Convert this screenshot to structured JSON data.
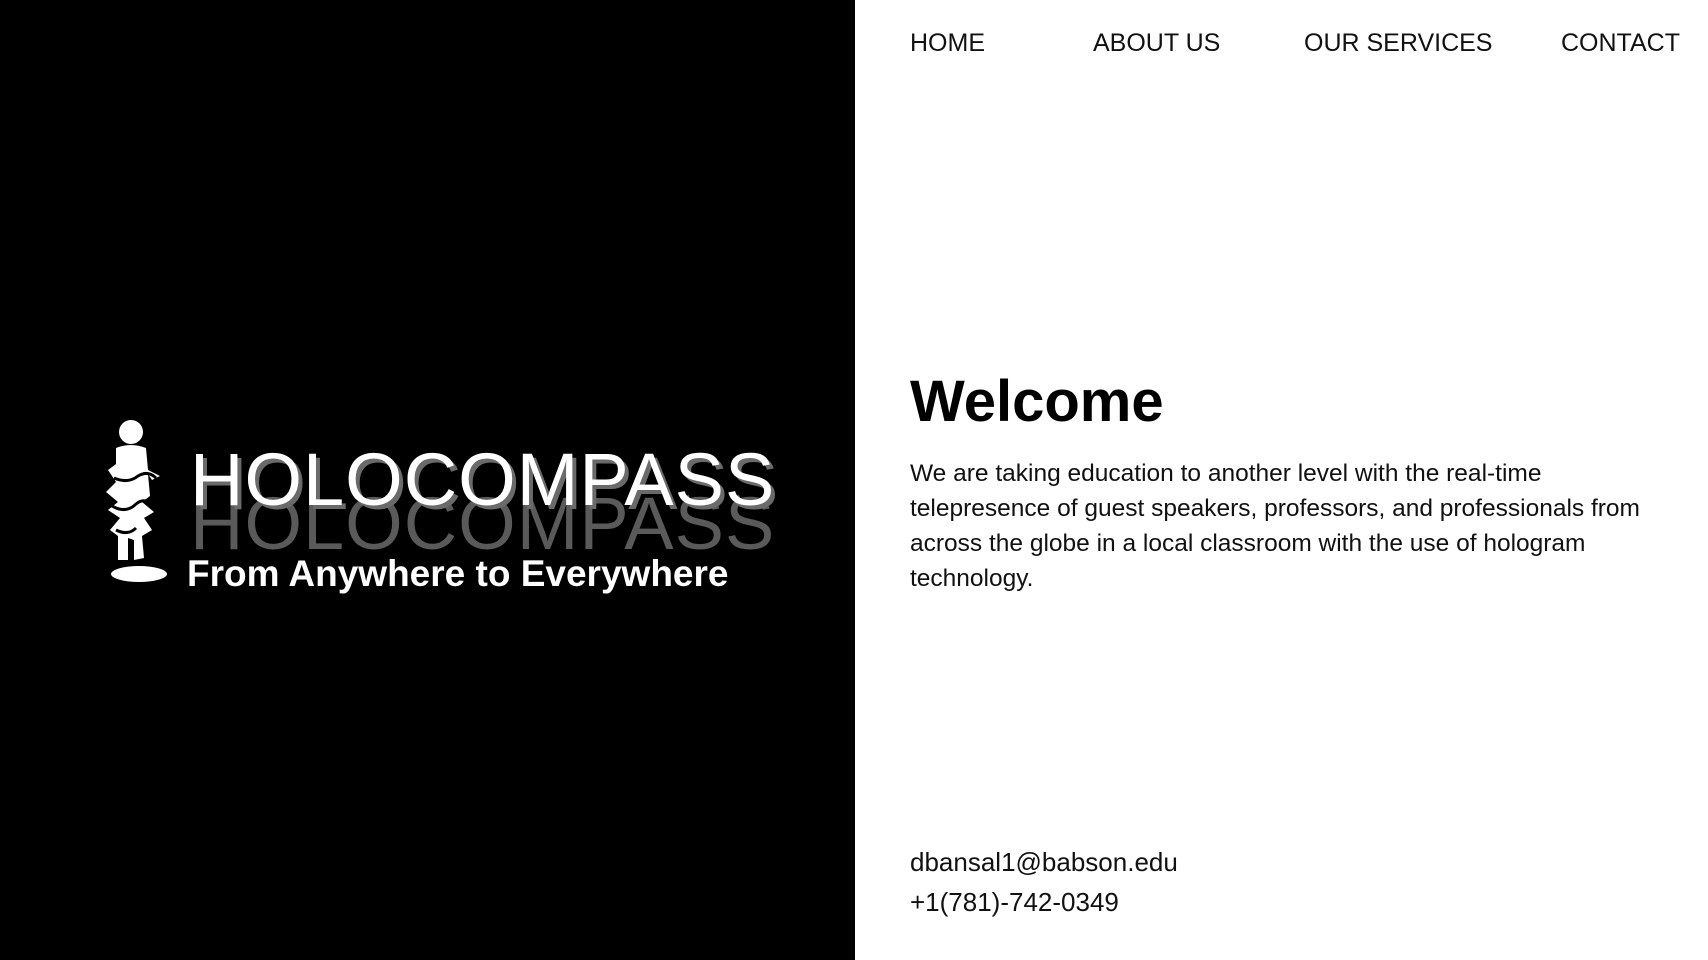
{
  "nav": {
    "items": [
      "HOME",
      "ABOUT US",
      "OUR SERVICES",
      "CONTACT"
    ]
  },
  "brand": {
    "logo_icon": "hologram-person-icon",
    "name": "HOLOCOMPASS",
    "tagline": "From Anywhere to Everywhere"
  },
  "main": {
    "title": "Welcome",
    "body": "We are taking education to another level with the real-time telepresence of guest speakers, professors, and professionals from across the globe in a local classroom with the use of hologram technology."
  },
  "contact": {
    "email": "dbansal1@babson.edu",
    "phone": "+1(781)-742-0349"
  },
  "colors": {
    "left_panel": "#000000",
    "right_panel": "#ffffff",
    "text_dark": "#111111",
    "text_light": "#ffffff"
  }
}
